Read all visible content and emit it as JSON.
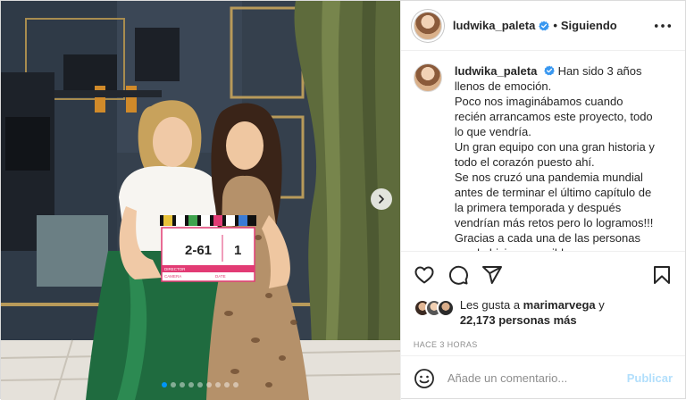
{
  "post": {
    "author": "ludwika_paleta",
    "verified_icon": "verified-badge-icon",
    "separator": "•",
    "follow_status": "Siguiendo",
    "more_icon": "more-horizontal-icon"
  },
  "caption": {
    "username": "ludwika_paleta",
    "lines": [
      "Han sido 3 años llenos de emoción.",
      "Poco nos imaginábamos cuando recién arrancamos este proyecto, todo lo que vendría.",
      "Un gran equipo con una gran historia y todo el corazón puesto ahí.",
      "Se nos cruzó una pandemia mundial antes de terminar el último capítulo de la primera temporada y después vendrían más retos pero lo logramos!!!",
      "Gracias a cada una de las personas que lo hicieron posible"
    ]
  },
  "actions": {
    "like_icon": "heart-icon",
    "comment_icon": "comment-icon",
    "share_icon": "share-icon",
    "save_icon": "bookmark-icon"
  },
  "likes": {
    "prefix": "Les gusta a",
    "first_user": "marimarvega",
    "conjunction": "y",
    "others": "22,173 personas más"
  },
  "timestamp": "HACE 3 HORAS",
  "comment_box": {
    "emoji_icon": "emoji-icon",
    "placeholder": "Añade un comentario...",
    "publish_label": "Publicar"
  },
  "carousel": {
    "next_icon": "chevron-right-icon",
    "slide_count": 9,
    "active_index": 0
  },
  "clapperboard": {
    "scene": "2-61",
    "take": "1",
    "field_director": "DIRECTOR",
    "field_camera": "CAMERA",
    "field_date": "DATE"
  },
  "colors": {
    "accent": "#0095f6",
    "publish_disabled": "#b2dffc",
    "verified": "#3897f0",
    "muted": "#8e8e8e"
  }
}
